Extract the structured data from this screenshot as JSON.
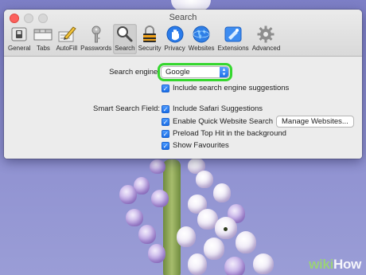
{
  "window": {
    "title": "Search"
  },
  "toolbar": {
    "tabs": [
      {
        "label": "General",
        "icon": "general-switch-icon"
      },
      {
        "label": "Tabs",
        "icon": "tabs-icon"
      },
      {
        "label": "AutoFill",
        "icon": "pencil-form-icon"
      },
      {
        "label": "Passwords",
        "icon": "key-icon"
      },
      {
        "label": "Search",
        "icon": "magnifier-icon",
        "active": true
      },
      {
        "label": "Security",
        "icon": "padlock-icon"
      },
      {
        "label": "Privacy",
        "icon": "hand-icon"
      },
      {
        "label": "Websites",
        "icon": "globe-icon"
      },
      {
        "label": "Extensions",
        "icon": "puzzle-icon"
      },
      {
        "label": "Advanced",
        "icon": "gear-icon"
      }
    ]
  },
  "search": {
    "engine_label": "Search engine:",
    "engine_value": "Google",
    "suggestions": "Include search engine suggestions",
    "smart_label": "Smart Search Field:",
    "safari_suggestions": "Include Safari Suggestions",
    "quick_website": "Enable Quick Website Search",
    "manage_button": "Manage Websites...",
    "preload": "Preload Top Hit in the background",
    "favourites": "Show Favourites"
  },
  "watermark": {
    "prefix": "wiki",
    "suffix": "How"
  },
  "colors": {
    "highlight": "#35d72e",
    "checkbox": "#1b6ee6",
    "close": "#fc605c"
  }
}
